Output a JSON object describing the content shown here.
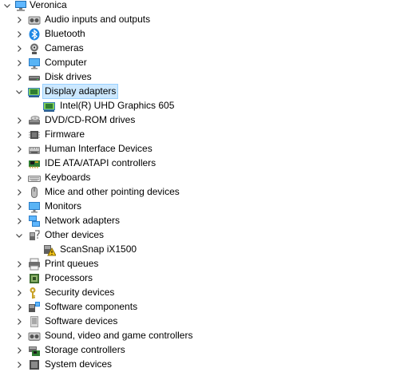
{
  "tree": {
    "root": {
      "label": "Veronica",
      "icon": "computer-icon"
    },
    "categories": [
      {
        "label": "Audio inputs and outputs",
        "icon": "speaker-icon"
      },
      {
        "label": "Bluetooth",
        "icon": "bluetooth-icon"
      },
      {
        "label": "Cameras",
        "icon": "camera-icon"
      },
      {
        "label": "Computer",
        "icon": "monitor-icon"
      },
      {
        "label": "Disk drives",
        "icon": "disk-drive-icon"
      },
      {
        "label": "Display adapters",
        "icon": "display-adapter-icon",
        "expanded": true,
        "selected": true,
        "children": [
          {
            "label": "Intel(R) UHD Graphics 605",
            "icon": "display-adapter-icon"
          }
        ]
      },
      {
        "label": "DVD/CD-ROM drives",
        "icon": "dvd-drive-icon"
      },
      {
        "label": "Firmware",
        "icon": "chip-icon"
      },
      {
        "label": "Human Interface Devices",
        "icon": "hid-icon"
      },
      {
        "label": "IDE ATA/ATAPI controllers",
        "icon": "controller-card-icon"
      },
      {
        "label": "Keyboards",
        "icon": "keyboard-icon"
      },
      {
        "label": "Mice and other pointing devices",
        "icon": "mouse-icon"
      },
      {
        "label": "Monitors",
        "icon": "monitor-icon"
      },
      {
        "label": "Network adapters",
        "icon": "network-icon"
      },
      {
        "label": "Other devices",
        "icon": "unknown-device-icon",
        "expanded": true,
        "children": [
          {
            "label": "ScanSnap iX1500",
            "icon": "warning-device-icon"
          }
        ]
      },
      {
        "label": "Print queues",
        "icon": "printer-icon"
      },
      {
        "label": "Processors",
        "icon": "processor-icon"
      },
      {
        "label": "Security devices",
        "icon": "key-icon"
      },
      {
        "label": "Software components",
        "icon": "software-component-icon"
      },
      {
        "label": "Software devices",
        "icon": "software-device-icon"
      },
      {
        "label": "Sound, video and game controllers",
        "icon": "speaker-icon"
      },
      {
        "label": "Storage controllers",
        "icon": "storage-controller-icon"
      },
      {
        "label": "System devices",
        "icon": "system-device-icon"
      }
    ]
  },
  "colors": {
    "selection_fill": "#cce8ff",
    "selection_border": "#99d1ff",
    "expander": "#444444"
  }
}
